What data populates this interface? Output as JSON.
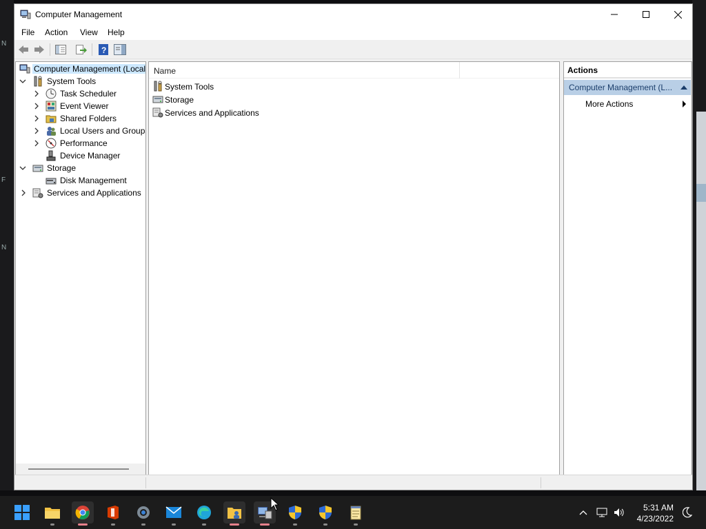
{
  "window": {
    "title": "Computer Management",
    "controls": {
      "minimize": "minimize",
      "maximize": "maximize",
      "close": "close"
    }
  },
  "menu": {
    "items": [
      "File",
      "Action",
      "View",
      "Help"
    ]
  },
  "toolbar": {
    "buttons": [
      "back-arrow-icon",
      "forward-arrow-icon",
      "show-hide-tree-icon",
      "export-list-icon",
      "help-icon",
      "show-hide-action-pane-icon"
    ]
  },
  "tree": {
    "items": [
      {
        "label": "Computer Management (Local",
        "icon": "computer-management-icon",
        "expander": "",
        "selected": true
      },
      {
        "label": "System Tools",
        "icon": "system-tools-icon",
        "expander": "expanded"
      },
      {
        "label": "Task Scheduler",
        "icon": "task-scheduler-icon",
        "expander": "collapsed"
      },
      {
        "label": "Event Viewer",
        "icon": "event-viewer-icon",
        "expander": "collapsed"
      },
      {
        "label": "Shared Folders",
        "icon": "shared-folders-icon",
        "expander": "collapsed"
      },
      {
        "label": "Local Users and Groups",
        "icon": "local-users-icon",
        "expander": "collapsed"
      },
      {
        "label": "Performance",
        "icon": "performance-icon",
        "expander": "collapsed"
      },
      {
        "label": "Device Manager",
        "icon": "device-manager-icon",
        "expander": ""
      },
      {
        "label": "Storage",
        "icon": "storage-icon",
        "expander": "expanded"
      },
      {
        "label": "Disk Management",
        "icon": "disk-management-icon",
        "expander": ""
      },
      {
        "label": "Services and Applications",
        "icon": "services-applications-icon",
        "expander": "collapsed"
      }
    ]
  },
  "list": {
    "column_header": "Name",
    "rows": [
      {
        "label": "System Tools",
        "icon": "system-tools-icon"
      },
      {
        "label": "Storage",
        "icon": "storage-icon"
      },
      {
        "label": "Services and Applications",
        "icon": "services-applications-icon"
      }
    ]
  },
  "actions": {
    "title": "Actions",
    "section_label": "Computer Management (L...",
    "items": [
      {
        "label": "More Actions"
      }
    ]
  },
  "taskbar": {
    "apps": [
      "start-icon",
      "file-explorer-icon",
      "chrome-icon",
      "office-icon",
      "settings-icon",
      "mail-icon",
      "edge-icon",
      "folder-user-icon",
      "computer-management-icon",
      "security-shield-icon",
      "security-shield-icon",
      "notepad-icon"
    ],
    "active_app": "computer-management-icon",
    "tray": [
      "chevron-up-icon",
      "network-icon",
      "volume-icon"
    ],
    "time": "5:31 AM",
    "date": "4/23/2022"
  },
  "colors": {
    "selection": "#cce8ff",
    "action_section": "#b9cfe6",
    "taskbar": "#1c1c1c",
    "active_pip": "#e8818c"
  }
}
